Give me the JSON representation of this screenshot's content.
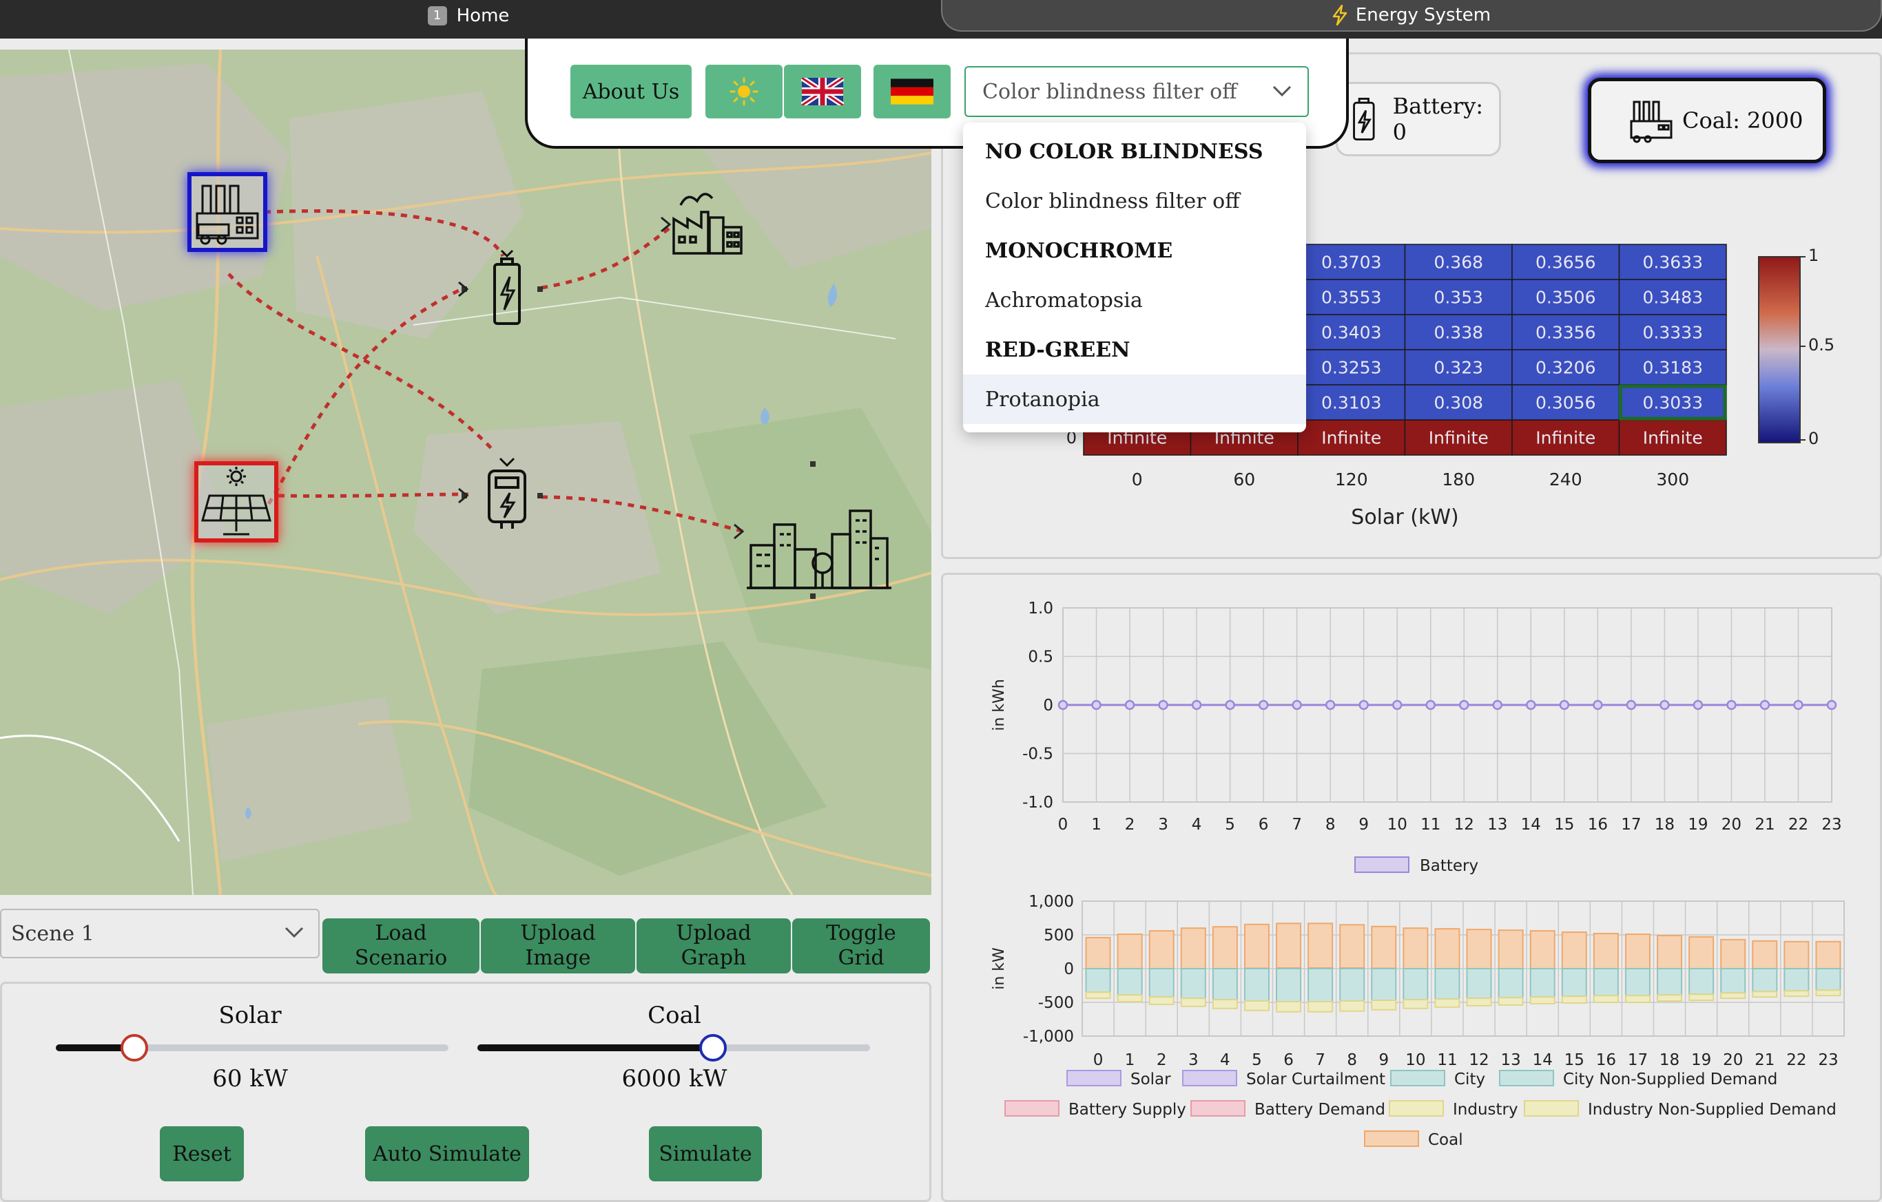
{
  "tabs": [
    {
      "number": "1",
      "label": "Home"
    },
    {
      "label": "Energy System",
      "icon": "lightning-icon"
    }
  ],
  "header": {
    "about_label": "About Us",
    "theme_icon": "sun-icon",
    "lang_en_icon": "uk-flag-icon",
    "lang_de_icon": "german-flag-icon",
    "colorblind_value": "Color blindness filter off"
  },
  "colorblind_dropdown": {
    "options": [
      {
        "label": "NO COLOR BLINDNESS",
        "group": true
      },
      {
        "label": "Color blindness filter off",
        "group": false
      },
      {
        "label": "MONOCHROME",
        "group": true
      },
      {
        "label": "Achromatopsia",
        "group": false
      },
      {
        "label": "RED-GREEN",
        "group": true
      },
      {
        "label": "Protanopia",
        "group": false,
        "highlighted": true
      }
    ]
  },
  "counters": {
    "battery": "Battery: 0",
    "coal": "Coal: 2000"
  },
  "map": {
    "nodes": [
      "coal-plant",
      "battery",
      "factory",
      "solar-panel",
      "transformer",
      "city"
    ]
  },
  "heatmap": {
    "xlabel": "Solar (kW)",
    "x_ticks": [
      "0",
      "60",
      "120",
      "180",
      "240",
      "300"
    ],
    "visible_y_tick": "0",
    "rows": [
      [
        "",
        "",
        "0.3703",
        "0.368",
        "0.3656",
        "0.3633"
      ],
      [
        "",
        "",
        "0.3553",
        "0.353",
        "0.3506",
        "0.3483"
      ],
      [
        "",
        "",
        "0.3403",
        "0.338",
        "0.3356",
        "0.3333"
      ],
      [
        "",
        "",
        "0.3253",
        "0.323",
        "0.3206",
        "0.3183"
      ],
      [
        "",
        "",
        "0.3103",
        "0.308",
        "0.3056",
        "0.3033"
      ],
      [
        "Infinite",
        "Infinite",
        "Infinite",
        "Infinite",
        "Infinite",
        "Infinite"
      ]
    ],
    "colorbar_ticks": [
      "1",
      "0.5",
      "0"
    ],
    "colors": {
      "blue": "#3a4fc0",
      "red": "#8f1818",
      "selected_border": "#1d6b2a"
    }
  },
  "chart_data": [
    {
      "type": "line",
      "x": [
        0,
        1,
        2,
        3,
        4,
        5,
        6,
        7,
        8,
        9,
        10,
        11,
        12,
        13,
        14,
        15,
        16,
        17,
        18,
        19,
        20,
        21,
        22,
        23
      ],
      "series": [
        {
          "name": "Battery",
          "values": [
            0,
            0,
            0,
            0,
            0,
            0,
            0,
            0,
            0,
            0,
            0,
            0,
            0,
            0,
            0,
            0,
            0,
            0,
            0,
            0,
            0,
            0,
            0,
            0
          ],
          "color": "#9a86d8"
        }
      ],
      "ylabel": "in kWh",
      "ylim": [
        -1.0,
        1.0
      ],
      "yticks": [
        "1.0",
        "0.5",
        "0",
        "-0.5",
        "-1.0"
      ],
      "grid": true,
      "legend": "bottom"
    },
    {
      "type": "bar",
      "categories": [
        "0",
        "1",
        "2",
        "3",
        "4",
        "5",
        "6",
        "7",
        "8",
        "9",
        "10",
        "11",
        "12",
        "13",
        "14",
        "15",
        "16",
        "17",
        "18",
        "19",
        "20",
        "21",
        "22",
        "23"
      ],
      "ylabel": "in kW",
      "ylim": [
        -1000,
        1000
      ],
      "yticks": [
        "1,000",
        "500",
        "0",
        "-500",
        "-1,000"
      ],
      "series": [
        {
          "name": "Solar",
          "values": [
            0,
            0,
            0,
            0,
            0,
            5,
            10,
            10,
            10,
            5,
            0,
            0,
            0,
            0,
            0,
            0,
            0,
            0,
            0,
            0,
            0,
            0,
            0,
            0
          ],
          "color": "#a89be0"
        },
        {
          "name": "Solar Curtailment",
          "values": [
            0,
            0,
            0,
            0,
            0,
            0,
            0,
            0,
            0,
            0,
            0,
            0,
            0,
            0,
            0,
            0,
            0,
            0,
            0,
            0,
            0,
            0,
            0,
            0
          ],
          "color": "#a89be0"
        },
        {
          "name": "City",
          "values": [
            -350,
            -390,
            -420,
            -440,
            -460,
            -480,
            -490,
            -490,
            -480,
            -470,
            -460,
            -450,
            -440,
            -430,
            -420,
            -410,
            -400,
            -400,
            -390,
            -380,
            -360,
            -340,
            -330,
            -320
          ],
          "color": "#8ec5c2"
        },
        {
          "name": "City Non-Supplied Demand",
          "values": [
            0,
            0,
            0,
            0,
            0,
            0,
            0,
            0,
            0,
            0,
            0,
            0,
            0,
            0,
            0,
            0,
            0,
            0,
            0,
            0,
            0,
            0,
            0,
            0
          ],
          "color": "#8ec5c2"
        },
        {
          "name": "Battery Supply",
          "values": [
            0,
            0,
            0,
            0,
            0,
            0,
            0,
            0,
            0,
            0,
            0,
            0,
            0,
            0,
            0,
            0,
            0,
            0,
            0,
            0,
            0,
            0,
            0,
            0
          ],
          "color": "#e89aa8"
        },
        {
          "name": "Battery Demand",
          "values": [
            0,
            0,
            0,
            0,
            0,
            0,
            0,
            0,
            0,
            0,
            0,
            0,
            0,
            0,
            0,
            0,
            0,
            0,
            0,
            0,
            0,
            0,
            0,
            0
          ],
          "color": "#e89aa8"
        },
        {
          "name": "Industry",
          "values": [
            -90,
            -100,
            -110,
            -120,
            -130,
            -140,
            -150,
            -150,
            -150,
            -140,
            -130,
            -120,
            -110,
            -110,
            -100,
            -100,
            -100,
            -100,
            -90,
            -90,
            -80,
            -80,
            -80,
            -80
          ],
          "color": "#e0d68a"
        },
        {
          "name": "Industry Non-Supplied Demand",
          "values": [
            0,
            0,
            0,
            0,
            0,
            0,
            0,
            0,
            0,
            0,
            0,
            0,
            0,
            0,
            0,
            0,
            0,
            0,
            0,
            0,
            0,
            0,
            0,
            0
          ],
          "color": "#e0d68a"
        },
        {
          "name": "Coal",
          "values": [
            460,
            510,
            560,
            600,
            620,
            650,
            660,
            660,
            640,
            620,
            600,
            590,
            580,
            570,
            560,
            540,
            520,
            510,
            490,
            470,
            430,
            410,
            400,
            400
          ],
          "color": "#f0a86a"
        }
      ],
      "legend": "bottom"
    }
  ],
  "scene": {
    "value": "Scene 1"
  },
  "buttons": {
    "load": "Load\nScenario",
    "upload_image": "Upload\nImage",
    "upload_graph": "Upload\nGraph",
    "toggle_grid": "Toggle\nGrid",
    "reset": "Reset",
    "auto_simulate": "Auto Simulate",
    "simulate": "Simulate"
  },
  "sliders": {
    "solar": {
      "label": "Solar",
      "value_text": "60 kW",
      "fraction": 0.2,
      "thumb_color": "#c0392b"
    },
    "coal": {
      "label": "Coal",
      "value_text": "6000 kW",
      "fraction": 0.6,
      "thumb_color": "#1e2bb0"
    }
  }
}
